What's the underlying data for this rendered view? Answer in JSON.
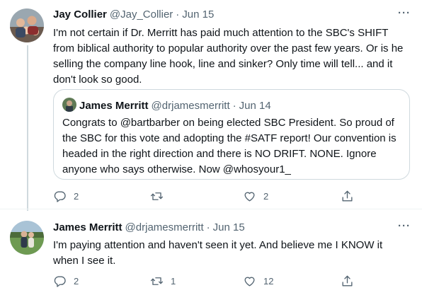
{
  "tweets": [
    {
      "name": "Jay Collier",
      "handle": "@Jay_Collier",
      "date": "Jun 15",
      "more": "···",
      "text": "I'm not certain if Dr. Merritt has paid much attention to the SBC's SHIFT from biblical authority to popular authority over the past few years. Or is he selling the company line hook, line and sinker? Only time will tell... and it don't look so good.",
      "quote": {
        "name": "James Merritt",
        "handle": "@drjamesmerritt",
        "date": "Jun 14",
        "text": "Congrats to @bartbarber on being elected SBC President. So proud of the SBC for this vote and adopting the #SATF report! Our convention is headed in the right direction and there is NO DRIFT. NONE. Ignore anyone who says otherwise. Now @whosyour1_"
      },
      "actions": {
        "reply": "2",
        "retweet": "",
        "like": "2"
      }
    },
    {
      "name": "James Merritt",
      "handle": "@drjamesmerritt",
      "date": "Jun 15",
      "more": "···",
      "text": "I'm paying attention and haven't seen it yet.  And believe me I KNOW it when I see it.",
      "actions": {
        "reply": "2",
        "retweet": "1",
        "like": "12"
      }
    }
  ],
  "separator": "·",
  "colors": {
    "text": "#0f1419",
    "secondary": "#536471",
    "border": "#cfd9de"
  },
  "icons": [
    "reply-icon",
    "retweet-icon",
    "like-icon",
    "share-icon",
    "more-icon"
  ]
}
